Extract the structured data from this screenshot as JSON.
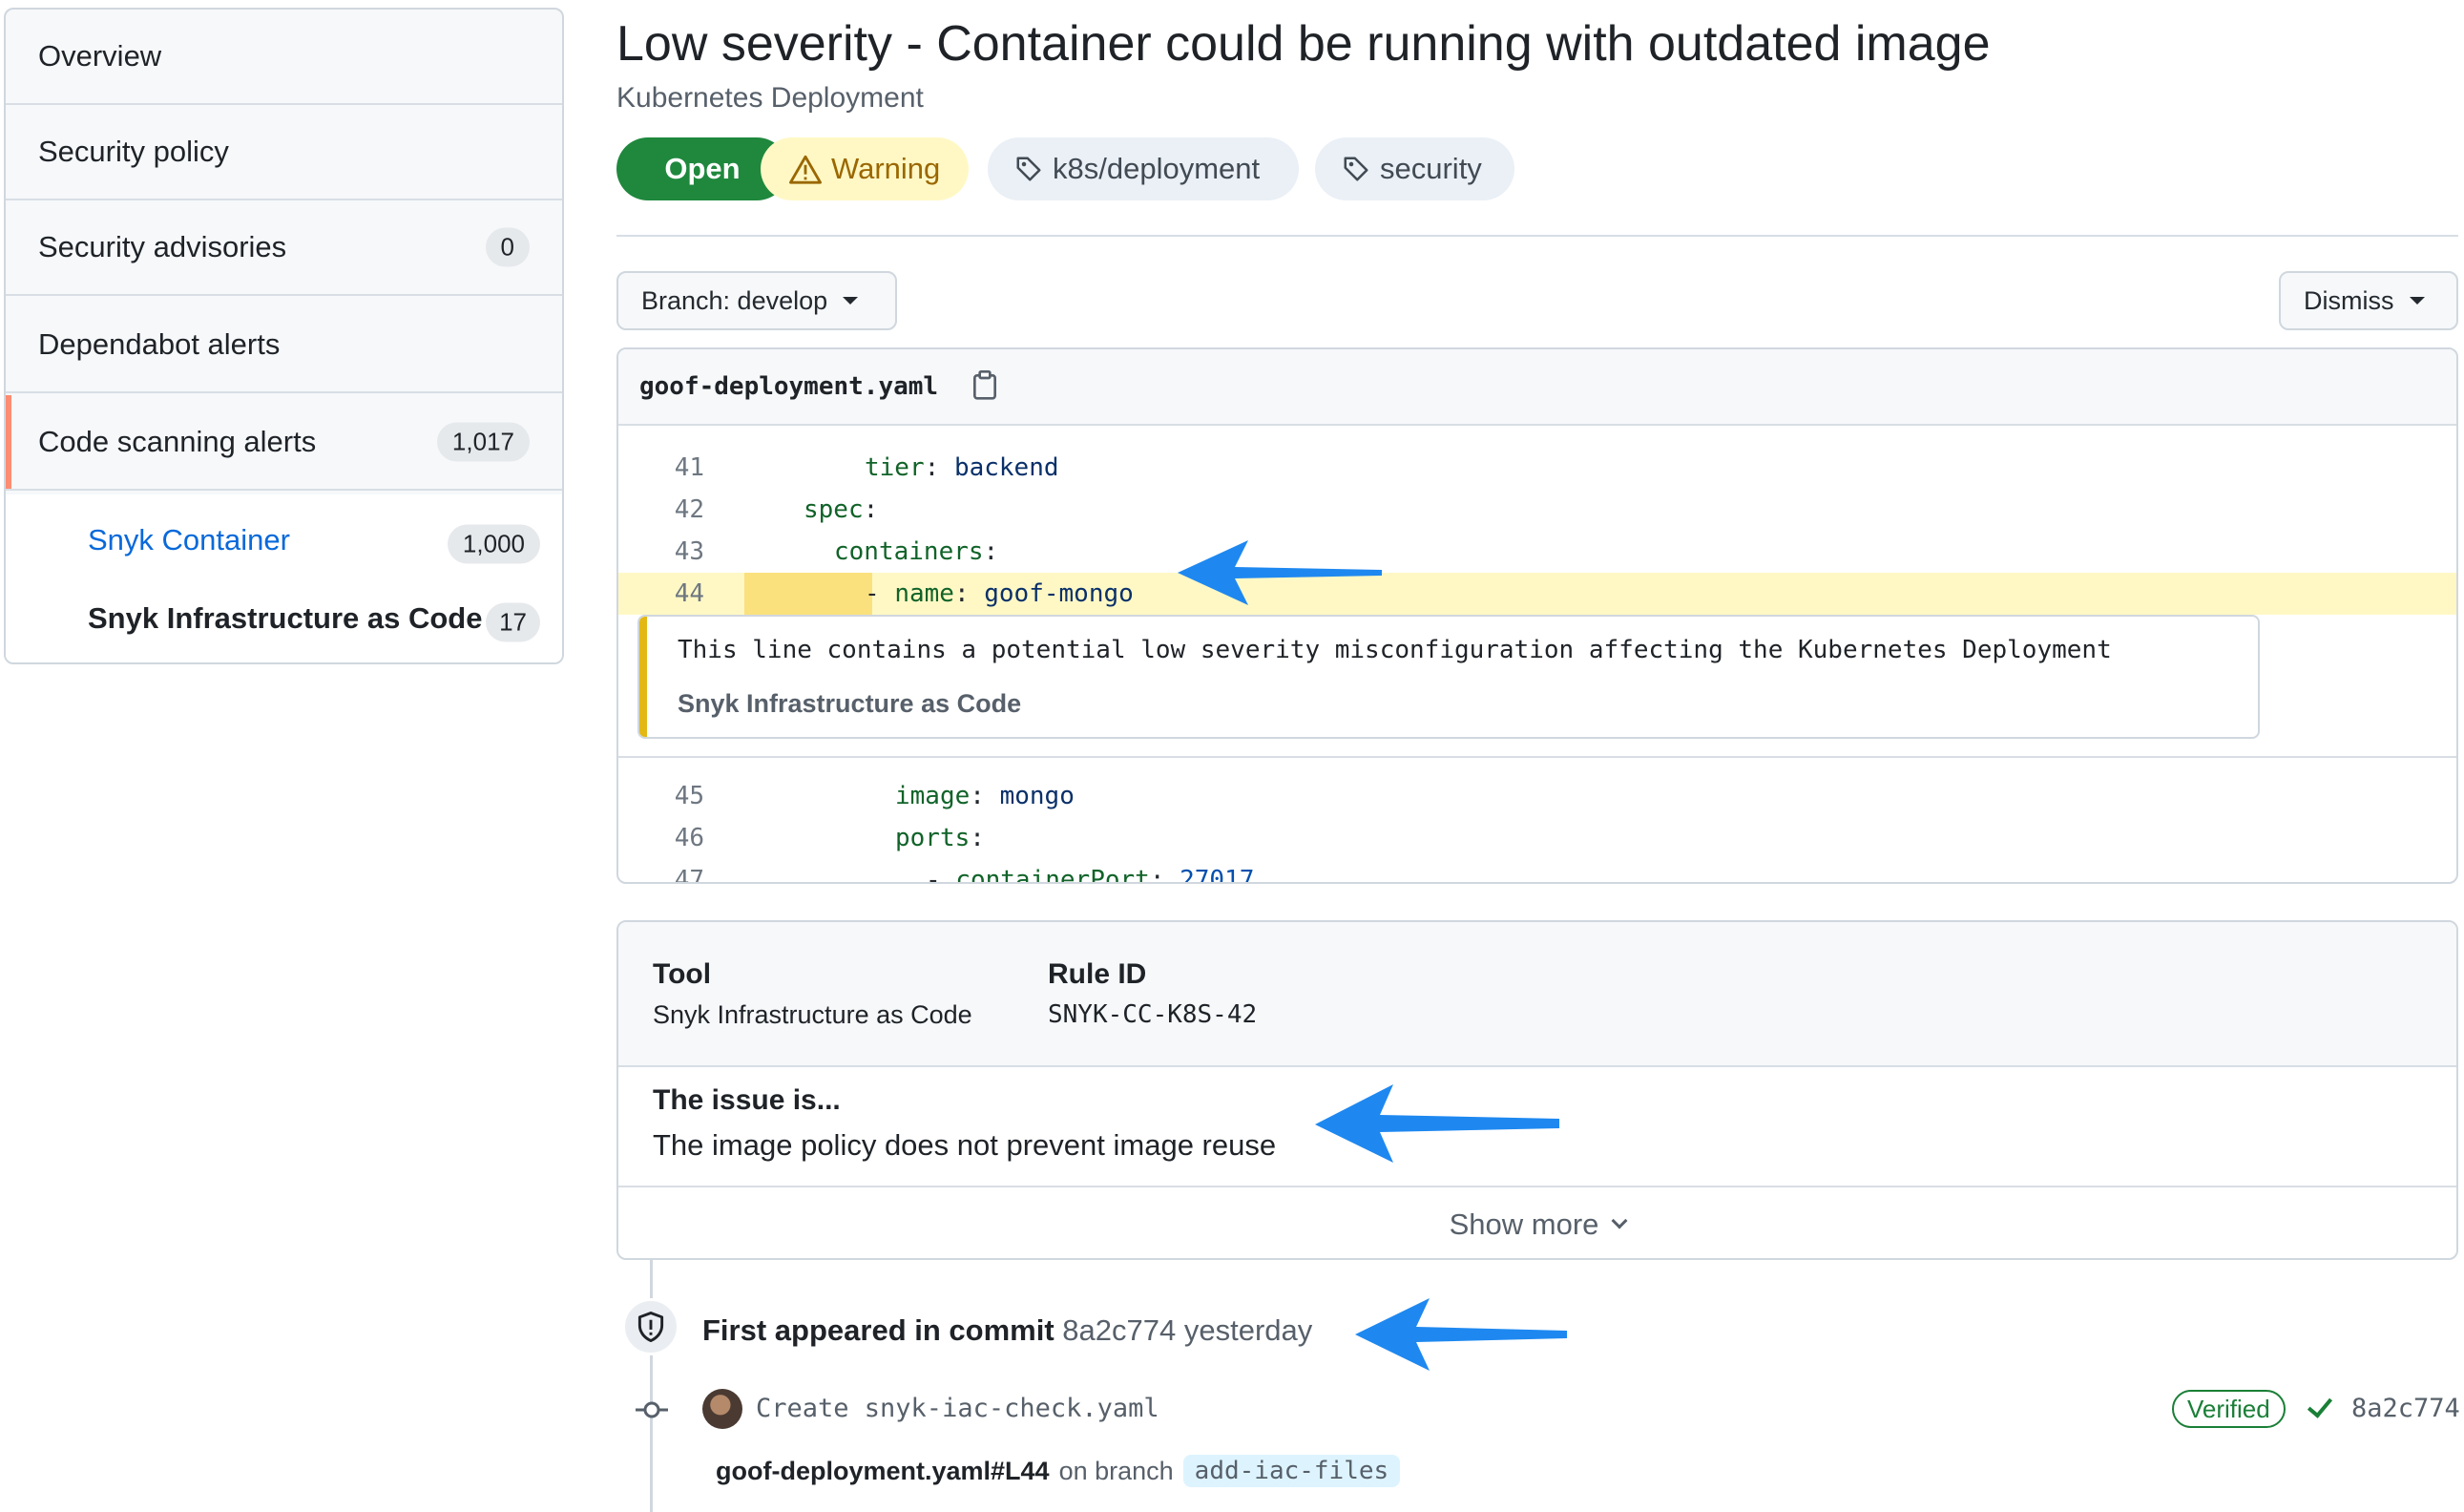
{
  "sidebar": {
    "items": [
      {
        "label": "Overview"
      },
      {
        "label": "Security policy"
      },
      {
        "label": "Security advisories",
        "count": "0"
      },
      {
        "label": "Dependabot alerts"
      },
      {
        "label": "Code scanning alerts",
        "count": "1,017"
      }
    ],
    "subitems": [
      {
        "label": "Snyk Container",
        "count": "1,000"
      },
      {
        "label": "Snyk Infrastructure as Code",
        "count": "17"
      }
    ]
  },
  "header": {
    "title": "Low severity - Container could be running with outdated image",
    "subtitle": "Kubernetes Deployment",
    "status": "Open",
    "severity": "Warning",
    "tags": [
      "k8s/deployment",
      "security"
    ]
  },
  "toolbar": {
    "branch_label": "Branch: develop",
    "dismiss_label": "Dismiss"
  },
  "code": {
    "filename": "goof-deployment.yaml",
    "lines_before": [
      {
        "num": "41",
        "key": "tier",
        "sep": ": ",
        "value": "backend"
      },
      {
        "num": "42",
        "key": "spec",
        "sep": ":",
        "value": ""
      },
      {
        "num": "43",
        "key": "containers",
        "sep": ":",
        "value": ""
      }
    ],
    "highlight": {
      "num": "44",
      "dash": "- ",
      "key": "name",
      "sep": ": ",
      "value": "goof-mongo"
    },
    "annotation": {
      "message": "This line contains a potential low severity misconfiguration affecting the Kubernetes Deployment",
      "source": "Snyk Infrastructure as Code"
    },
    "lines_after": [
      {
        "num": "45",
        "key": "image",
        "sep": ": ",
        "value": "mongo"
      },
      {
        "num": "46",
        "key": "ports",
        "sep": ":",
        "value": ""
      },
      {
        "num": "47",
        "dash": "- ",
        "key": "containerPort",
        "sep": ": ",
        "value": "27017"
      }
    ]
  },
  "details": {
    "tool_label": "Tool",
    "tool_value": "Snyk Infrastructure as Code",
    "rule_label": "Rule ID",
    "rule_value": "SNYK-CC-K8S-42",
    "issue_label": "The issue is...",
    "issue_desc": "The image policy does not prevent image reuse",
    "show_more": "Show more"
  },
  "timeline": {
    "first_appeared_label": "First appeared in commit",
    "first_appeared_sha": "8a2c774",
    "first_appeared_when": "yesterday",
    "commit_message": "Create snyk-iac-check.yaml",
    "verified": "Verified",
    "commit_sha": "8a2c774",
    "file_ref": "goof-deployment.yaml#L44",
    "on_branch": "on branch",
    "branch": "add-iac-files"
  },
  "colors": {
    "accent_open": "#1f883d",
    "warning_bg": "#fff8c5",
    "highlight_line": "#fff8c5",
    "arrow": "#1e88f0",
    "nav_selected_bar": "#fd8c73",
    "link": "#0969da"
  },
  "icons": [
    "warning-icon",
    "tag-icon",
    "clipboard-icon",
    "shield-icon",
    "commit-icon",
    "check-icon",
    "chevron-down-icon",
    "caret-down-icon",
    "arrow-annotation-icon"
  ]
}
